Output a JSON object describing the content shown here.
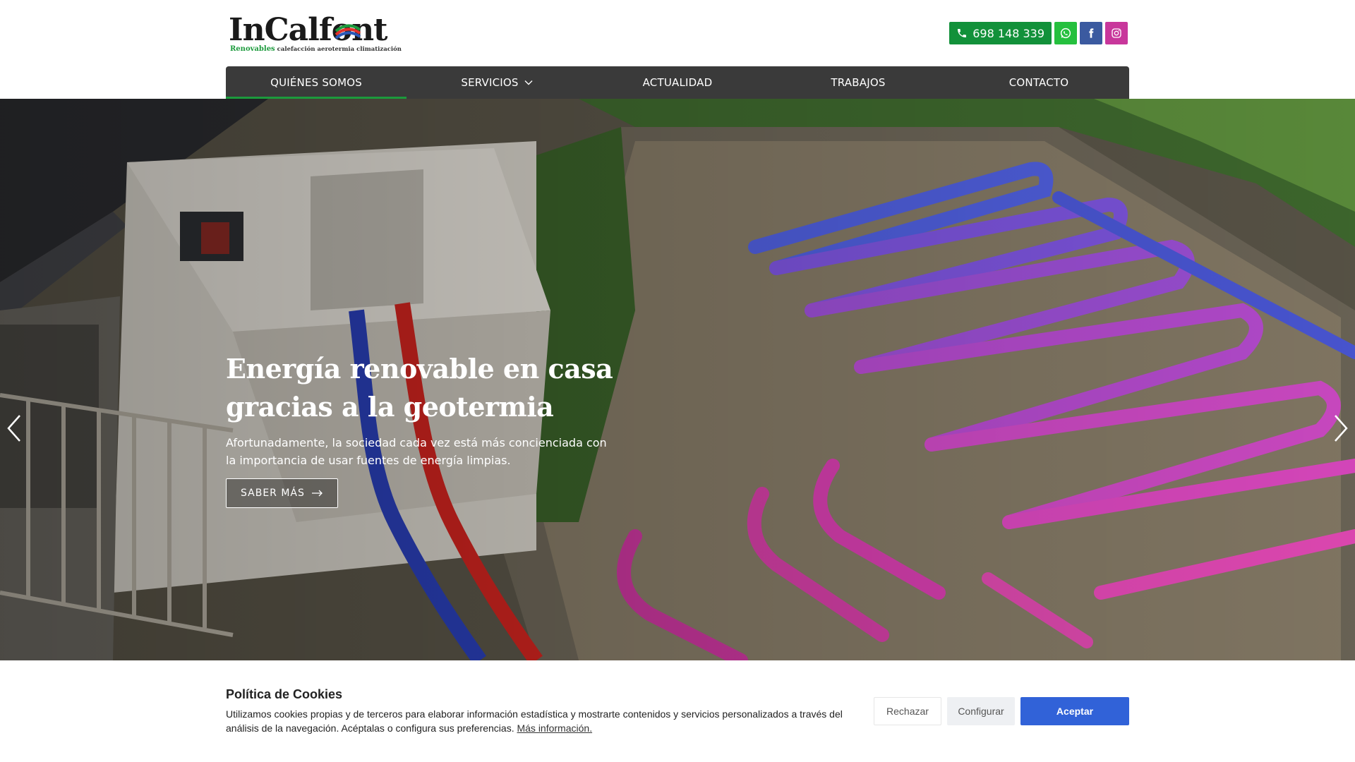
{
  "header": {
    "logo": {
      "main": "InCalfont",
      "sub_green": "Renovables",
      "sub_rest": "calefacción aerotermia climatización"
    },
    "phone_label": "698 148 339",
    "social": [
      "whatsapp-icon",
      "facebook-icon",
      "instagram-icon"
    ],
    "colors": {
      "green": "#1c9a3c",
      "whatsapp": "#25c03e",
      "facebook": "#3b5aa0",
      "instagram": "#c8379b",
      "nav_bg": "#3a3a3a"
    }
  },
  "nav": {
    "items": [
      {
        "label": "QUIÉNES SOMOS",
        "active": true
      },
      {
        "label": "SERVICIOS",
        "dropdown": true
      },
      {
        "label": "ACTUALIDAD"
      },
      {
        "label": "TRABAJOS"
      },
      {
        "label": "CONTACTO"
      }
    ]
  },
  "hero": {
    "title": "Energía renovable en casa gracias a la geotermia",
    "text": "Afortunadamente, la sociedad cada vez está más concienciada con la importancia de usar fuentes de energía limpias.",
    "button_label": "SABER MÁS"
  },
  "cookies": {
    "title": "Política de Cookies",
    "text": "Utilizamos cookies propias y de terceros para elaborar información estadística y mostrarte contenidos y servicios personalizados a través del análisis de la navegación. Acéptalas o configura sus preferencias.",
    "link_label": "Más información.",
    "reject_label": "Rechazar",
    "configure_label": "Configurar",
    "accept_label": "Aceptar",
    "accent": "#3162d8"
  }
}
